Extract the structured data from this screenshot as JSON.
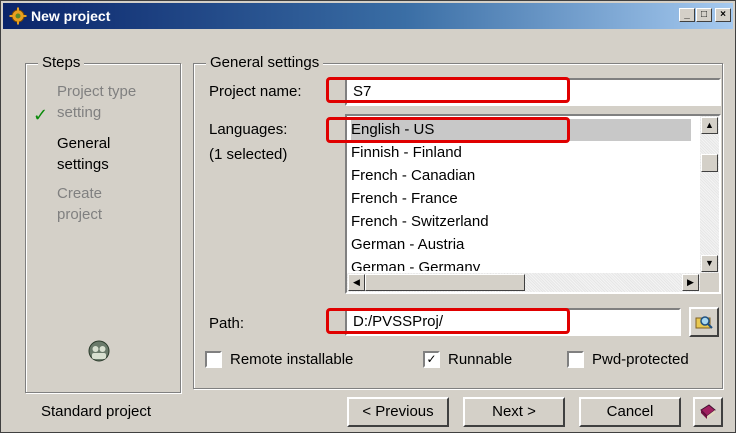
{
  "window": {
    "title": "New project",
    "controls": [
      "_",
      "□",
      "×"
    ]
  },
  "steps": {
    "legend": "Steps",
    "items": [
      {
        "label": "Project type setting",
        "line1": "Project type",
        "line2": "setting",
        "state": "done"
      },
      {
        "label": "General settings",
        "line1": "General",
        "line2": "settings",
        "state": "current"
      },
      {
        "label": "Create project",
        "line1": "Create",
        "line2": "project",
        "state": "pending"
      }
    ],
    "check_glyph": "✓"
  },
  "general": {
    "legend": "General settings",
    "project_name_label": "Project name:",
    "project_name_value": "S7",
    "languages_label": "Languages:",
    "languages_count": "(1 selected)",
    "languages": [
      "English - US",
      "Finnish - Finland",
      "French - Canadian",
      "French - France",
      "French - Switzerland",
      "German - Austria",
      "German - Germany"
    ],
    "selected_language": "English - US",
    "path_label": "Path:",
    "path_value": "D:/PVSSProj/"
  },
  "options": {
    "remote_installable": {
      "label": "Remote installable",
      "checked": false
    },
    "runnable": {
      "label": "Runnable",
      "checked": true
    },
    "pwd_protected": {
      "label": "Pwd-protected",
      "checked": false
    }
  },
  "footer": {
    "project_type": "Standard project",
    "previous_label": "< Previous",
    "next_label": "Next >",
    "cancel_label": "Cancel"
  },
  "colors": {
    "highlight": "#e00000",
    "check": "#0a8a0a",
    "title_start": "#0a246a",
    "title_end": "#a6caf0"
  }
}
